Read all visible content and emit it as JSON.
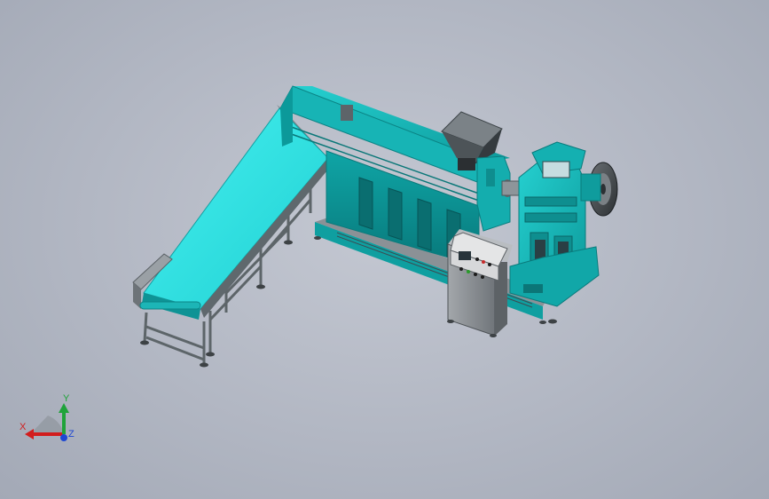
{
  "triad": {
    "x_label": "X",
    "y_label": "Y",
    "z_label": "Z"
  },
  "colors": {
    "background": "#b8bdc8",
    "machine_body": "#12bcbc",
    "machine_dark": "#0a8e8f",
    "belt": "#33e6e6",
    "control_cabinet": "#8e9296",
    "control_panel": "#e6e6e6",
    "x_axis": "#d21d1d",
    "y_axis": "#1fa33a",
    "z_axis": "#1d47d2"
  }
}
